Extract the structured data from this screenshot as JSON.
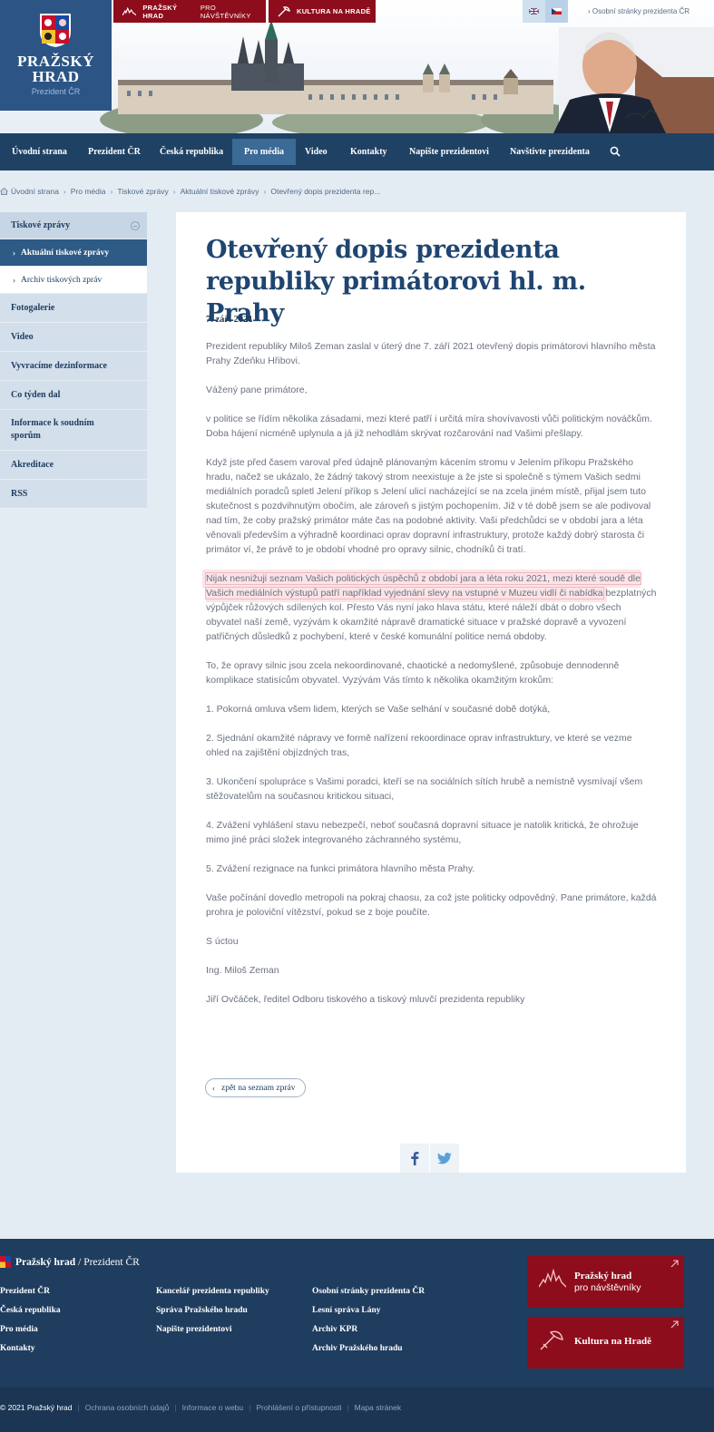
{
  "header": {
    "logo_title": "PRAŽSKÝ HRAD",
    "logo_subtitle": "Prezident ČR",
    "visitor_button_bold": "PRAŽSKÝ HRAD",
    "visitor_button_rest": "PRO NÁVŠTĚVNÍKY",
    "culture_button": "KULTURA NA HRADĚ",
    "personal_link": "› Osobní stránky prezidenta ČR"
  },
  "nav": {
    "items": [
      "Úvodní strana",
      "Prezident ČR",
      "Česká republika",
      "Pro média",
      "Video",
      "Kontakty",
      "Napište prezidentovi",
      "Navštivte prezidenta"
    ],
    "active": "Pro média"
  },
  "breadcrumb": [
    "Úvodní strana",
    "Pro média",
    "Tiskové zprávy",
    "Aktuální tiskové zprávy",
    "Otevřený dopis prezidenta rep..."
  ],
  "sidebar": {
    "section": "Tiskové zprávy",
    "sub_items": [
      "Aktuální tiskové zprávy",
      "Archiv tiskových zpráv"
    ],
    "items": [
      "Fotogalerie",
      "Video",
      "Vyvracíme dezinformace",
      "Co týden dal",
      "Informace k soudním sporům",
      "Akreditace",
      "RSS"
    ]
  },
  "article": {
    "title": "Otevřený dopis prezidenta republiky primátorovi hl. m. Prahy",
    "date": "7. září 2021",
    "paragraphs": [
      "Prezident republiky Miloš Zeman zaslal v úterý dne 7. září 2021 otevřený dopis primátorovi hlavního města Prahy Zdeňku Hřibovi.",
      "Vážený pane primátore,",
      "v politice se řídím několika zásadami, mezi které patří i určitá míra shovívavosti vůči politickým nováčkům. Doba hájení nicméně uplynula a já již nehodlám skrývat rozčarování nad Vašimi přešlapy.",
      "Když jste před časem varoval před údajně plánovaným kácením stromu v Jelením příkopu Pražského hradu, načež se ukázalo, že žádný takový strom neexistuje a že jste si společně s týmem Vašich sedmi mediálních poradců spletl Jelení příkop s Jelení ulicí nacházející se na zcela jiném místě, přijal jsem tuto skutečnost s pozdvihnutým obočím, ale zároveň s jistým pochopením. Již v té době jsem se ale podivoval nad tím, že coby pražský primátor máte čas na podobné aktivity. Vaši předchůdci se v období jara a léta věnovali především a výhradně koordinaci oprav dopravní infrastruktury, protože každý dobrý starosta či primátor ví, že právě to je období vhodné pro opravy silnic, chodníků či tratí."
    ],
    "highlight": "Nijak nesnižuji seznam Vašich politických úspěchů z období jara a léta roku 2021, mezi které soudě dle Vašich mediálních výstupů patří například vyjednání slevy na vstupné v Muzeu vidlí či nabídka",
    "highlight_rest": " bezplatných výpůjček růžových sdílených kol. Přesto Vás nyní jako hlava státu, které náleží dbát o dobro všech obyvatel naší země, vyzývám k okamžité nápravě dramatické situace v pražské dopravě a vyvození patřičných důsledků z pochybení, které v české komunální politice nemá obdoby.",
    "paragraphs_after": [
      "To, že opravy silnic jsou zcela nekoordinované, chaotické a nedomyšlené, způsobuje dennodenně komplikace statisícům obyvatel. Vyzývám Vás tímto k několika okamžitým krokům:",
      "1. Pokorná omluva všem lidem, kterých se Vaše selhání v současné době dotýká,",
      "2. Sjednání okamžité nápravy ve formě nařízení rekoordinace oprav infrastruktury, ve které se vezme ohled na zajištění objízdných tras,",
      "3. Ukončení spolupráce s Vašimi poradci, kteří se na sociálních sítích hrubě a nemístně vysmívají všem stěžovatelům na současnou kritickou situaci,",
      "4. Zvážení vyhlášení stavu nebezpečí, neboť současná dopravní situace je natolik kritická, že ohrožuje mimo jiné práci složek integrovaného záchranného systému,",
      "5. Zvážení rezignace na funkci primátora hlavního města Prahy.",
      "Vaše počínání dovedlo metropoli na pokraj chaosu, za což jste politicky odpovědný. Pane primátore, každá prohra je poloviční vítězství, pokud se z boje poučíte.",
      "S úctou",
      "Ing. Miloš Zeman",
      "Jiří Ovčáček, ředitel Odboru tiskového a tiskový mluvčí prezidenta republiky"
    ],
    "back_button": "zpět na seznam zpráv"
  },
  "footer": {
    "brand_bold": "Pražský hrad",
    "brand_rest": "/ Prezident ČR",
    "col1": [
      "Prezident ČR",
      "Česká republika",
      "Pro média",
      "Kontakty"
    ],
    "col2": [
      "Kancelář prezidenta republiky",
      "Správa Pražského hradu",
      "Napište prezidentovi"
    ],
    "col3": [
      "Osobní stránky prezidenta ČR",
      "Lesní správa Lány",
      "Archiv KPR",
      "Archiv Pražského hradu"
    ],
    "card1_title": "Pražský hrad",
    "card1_sub": "pro návštěvníky",
    "card2_title": "Kultura na Hradě"
  },
  "bottom": {
    "copyright": "© 2021 Pražský hrad",
    "links": [
      "Ochrana osobních údajů",
      "Informace o webu",
      "Prohlášení o přístupnosti",
      "Mapa stránek"
    ]
  },
  "colors": {
    "brand_blue": "#2c5585",
    "nav_blue": "#1f4164",
    "accent_red": "#8e0d1c",
    "footer_blue": "#1f3d5f"
  }
}
